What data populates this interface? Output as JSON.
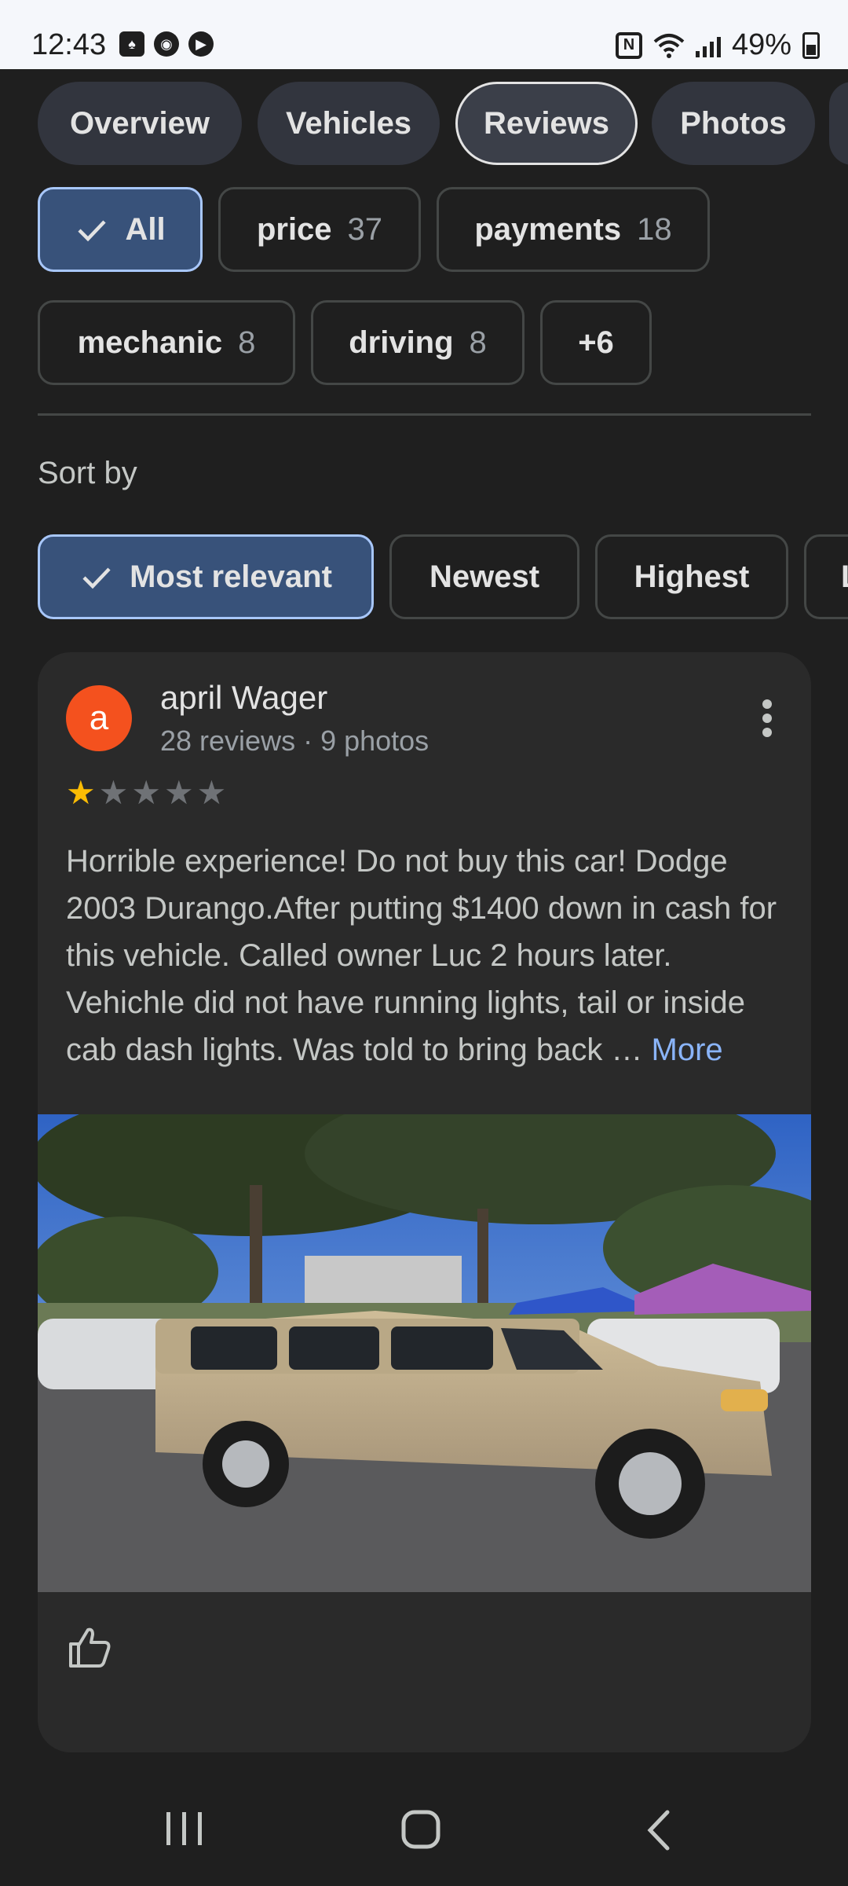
{
  "status_bar": {
    "time": "12:43",
    "battery": "49%",
    "nfc": "N",
    "icons": [
      "cards-icon",
      "sync-icon",
      "play-icon",
      "wifi-icon",
      "signal-icon",
      "battery-icon"
    ]
  },
  "tabs": [
    "Overview",
    "Vehicles",
    "Reviews",
    "Photos"
  ],
  "filters": {
    "all": "All",
    "price": {
      "label": "price",
      "count": "37"
    },
    "payments": {
      "label": "payments",
      "count": "18"
    },
    "mechanic": {
      "label": "mechanic",
      "count": "8"
    },
    "driving": {
      "label": "driving",
      "count": "8"
    },
    "more": "+6"
  },
  "sort": {
    "label": "Sort by",
    "options": [
      "Most relevant",
      "Newest",
      "Highest",
      "L"
    ]
  },
  "review": {
    "avatar_letter": "a",
    "name": "april Wager",
    "meta": "28 reviews · 9 photos",
    "rating": 1,
    "text": "Horrible experience! Do not buy this car! Dodge 2003 Durango.After putting $1400 down in cash for this vehicle. Called owner Luc 2 hours later. Vehichle did not have running lights, tail or inside cab dash lights. Was told to bring back … ",
    "more": "More"
  },
  "colors": {
    "accent_chip": "#38527a",
    "avatar": "#f4511e",
    "link": "#8ab4f8",
    "star": "#fbbc04"
  }
}
